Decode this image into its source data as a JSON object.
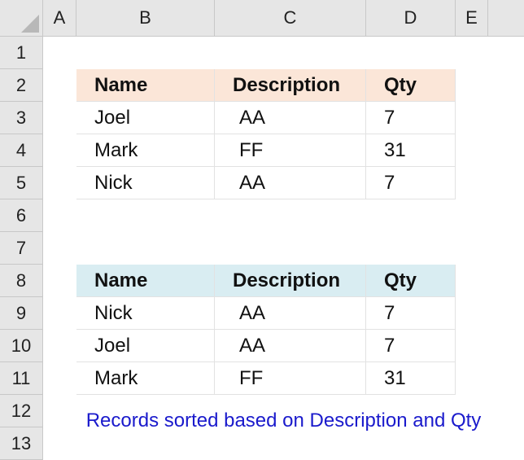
{
  "columns": [
    "A",
    "B",
    "C",
    "D",
    "E"
  ],
  "rows": [
    "1",
    "2",
    "3",
    "4",
    "5",
    "6",
    "7",
    "8",
    "9",
    "10",
    "11",
    "12",
    "13"
  ],
  "table1": {
    "headers": [
      "Name",
      "Description",
      "Qty"
    ],
    "rows": [
      [
        "Joel",
        "AA",
        "7"
      ],
      [
        "Mark",
        "FF",
        "31"
      ],
      [
        "Nick",
        "AA",
        "7"
      ]
    ]
  },
  "table2": {
    "headers": [
      "Name",
      "Description",
      "Qty"
    ],
    "rows": [
      [
        "Nick",
        "AA",
        "7"
      ],
      [
        "Joel",
        "AA",
        "7"
      ],
      [
        "Mark",
        "FF",
        "31"
      ]
    ]
  },
  "caption": "Records sorted based on Description and Qty",
  "colors": {
    "table1_header": "#fbe6d8",
    "table2_header": "#d9edf2",
    "caption": "#1a1acc"
  }
}
